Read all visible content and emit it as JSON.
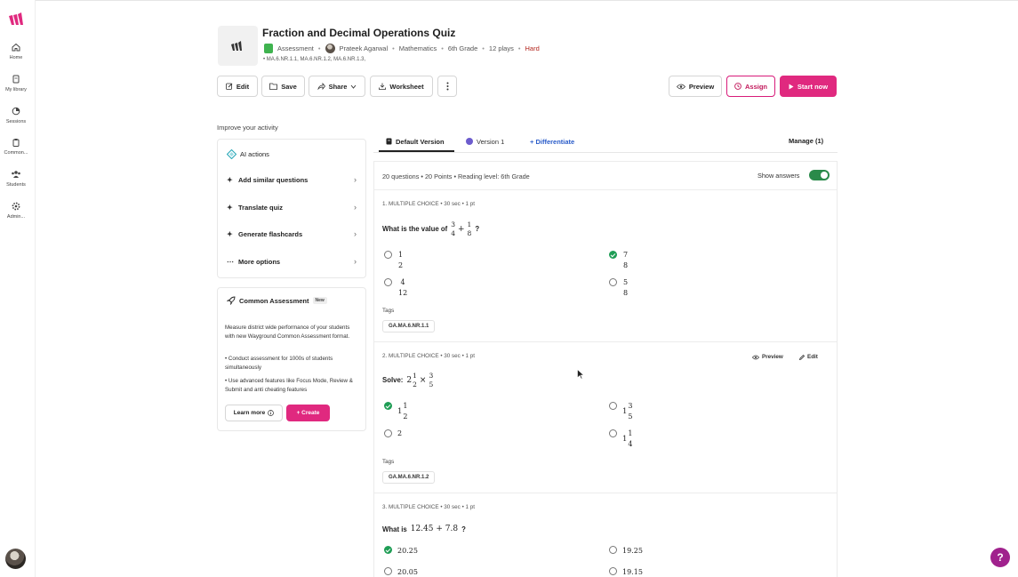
{
  "sidebar": {
    "items": [
      {
        "label": "Home",
        "icon": "home-icon"
      },
      {
        "label": "My library",
        "icon": "library-icon"
      },
      {
        "label": "Sessions",
        "icon": "sessions-icon"
      },
      {
        "label": "Common...",
        "icon": "clipboard-icon"
      },
      {
        "label": "Students",
        "icon": "students-icon"
      },
      {
        "label": "Admin...",
        "icon": "gear-icon"
      }
    ]
  },
  "header": {
    "title": "Fraction and Decimal Operations Quiz",
    "type": "Assessment",
    "author": "Prateek Agarwal",
    "subject": "Mathematics",
    "grade": "6th Grade",
    "plays": "12 plays",
    "difficulty": "Hard",
    "standards": "• MA.6.NR.1.1, MA.6.NR.1.2, MA.6.NR.1.3,"
  },
  "toolbar": {
    "edit": "Edit",
    "save": "Save",
    "share": "Share",
    "worksheet": "Worksheet",
    "preview": "Preview",
    "assign": "Assign",
    "start": "Start now"
  },
  "improve": {
    "heading": "Improve your activity",
    "ai_title": "AI actions",
    "items": [
      "Add similar questions",
      "Translate quiz",
      "Generate flashcards",
      "More options"
    ]
  },
  "common_assessment": {
    "title": "Common Assessment",
    "badge": "New",
    "description": "Measure district wide performance of your students with new Wayground Common Assessment format.",
    "bullet1": "• Conduct assessment for 1000s of students simultaneously",
    "bullet2": "• Use advanced features like Focus Mode, Review & Submit and anti cheating features",
    "learn_more": "Learn more",
    "create": "+ Create"
  },
  "tabs": {
    "default": "Default Version",
    "version1": "Version 1",
    "differentiate": "+ Differentiate",
    "manage": "Manage (1)"
  },
  "summary": "20 questions • 20 Points • Reading level: 6th Grade",
  "show_answers": "Show answers",
  "tags_label": "Tags",
  "actions": {
    "preview": "Preview",
    "edit": "Edit"
  },
  "q1": {
    "header": "1. MULTIPLE CHOICE • 30 sec • 1 pt",
    "prompt": "What is the value of",
    "expr_a_num": "3",
    "expr_a_den": "4",
    "expr_op": "+",
    "expr_b_num": "1",
    "expr_b_den": "8",
    "suffix": "?",
    "options": [
      {
        "num": "1",
        "den": "2",
        "correct": false
      },
      {
        "num": "7",
        "den": "8",
        "correct": true
      },
      {
        "num": "4",
        "den": "12",
        "correct": false
      },
      {
        "num": "5",
        "den": "8",
        "correct": false
      }
    ],
    "tag": "GA.MA.6.NR.1.1"
  },
  "q2": {
    "header": "2. MULTIPLE CHOICE • 30 sec • 1 pt",
    "prompt": "Solve:",
    "expr_a_int": "2",
    "expr_a_num": "1",
    "expr_a_den": "2",
    "expr_op": "×",
    "expr_b_num": "3",
    "expr_b_den": "5",
    "options": [
      {
        "int": "1",
        "num": "1",
        "den": "2",
        "correct": true
      },
      {
        "int": "1",
        "num": "3",
        "den": "5",
        "correct": false
      },
      {
        "value": "2",
        "correct": false
      },
      {
        "int": "1",
        "num": "1",
        "den": "4",
        "correct": false
      }
    ],
    "tag": "GA.MA.6.NR.1.2"
  },
  "q3": {
    "header": "3. MULTIPLE CHOICE • 30 sec • 1 pt",
    "prompt": "What is",
    "expr": "12.45 + 7.8",
    "suffix": "?",
    "options": [
      {
        "value": "20.25",
        "correct": true
      },
      {
        "value": "19.25",
        "correct": false
      },
      {
        "value": "20.05",
        "correct": false
      },
      {
        "value": "19.15",
        "correct": false
      }
    ]
  },
  "help": "?",
  "colors": {
    "brand": "#e0297f",
    "correct": "#1f9d55",
    "hard": "#b3261e",
    "help": "#a0218d"
  }
}
